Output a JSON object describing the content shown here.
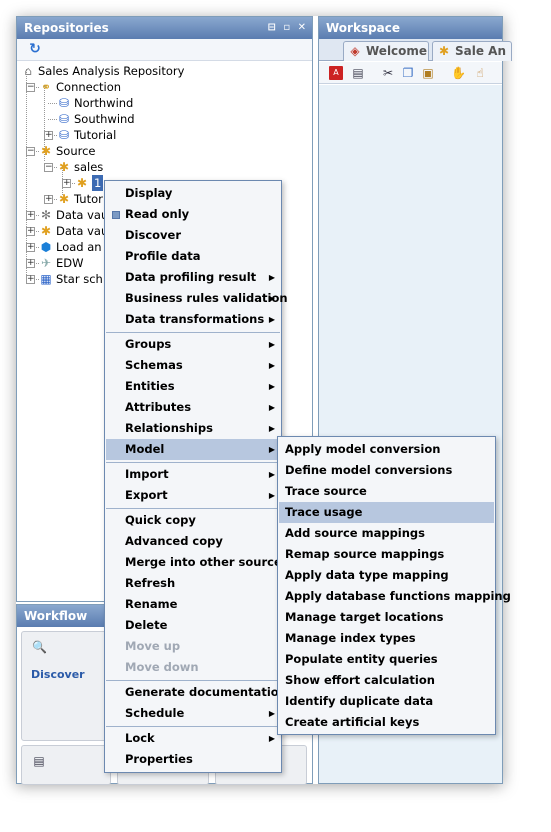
{
  "repositories": {
    "title": "Repositories",
    "controls": "⊟ ▫ ✕",
    "tree": [
      {
        "label": "Sales Analysis Repository",
        "icon": "repository-icon"
      },
      {
        "label": "Connection",
        "icon": "connection-icon"
      },
      {
        "label": "Northwind",
        "icon": "database-icon"
      },
      {
        "label": "Southwind",
        "icon": "database-icon"
      },
      {
        "label": "Tutorial",
        "icon": "database-icon"
      },
      {
        "label": "Source",
        "icon": "source-icon"
      },
      {
        "label": "sales",
        "icon": "source-icon"
      },
      {
        "label": "1",
        "icon": "source-icon"
      },
      {
        "label": "Tutor",
        "icon": "source-icon"
      },
      {
        "label": "Data vau",
        "icon": "data-vault-icon"
      },
      {
        "label": "Data vau",
        "icon": "data-vault-icon"
      },
      {
        "label": "Load an",
        "icon": "load-icon"
      },
      {
        "label": "EDW",
        "icon": "edw-icon"
      },
      {
        "label": "Star sch",
        "icon": "star-schema-icon"
      }
    ]
  },
  "workspace": {
    "title": "Workspace",
    "tabs": [
      {
        "label": "Welcome"
      },
      {
        "label": "Sale An"
      }
    ]
  },
  "workflow": {
    "title": "Workflow",
    "discover_label": "Discover"
  },
  "context_menu": {
    "items": [
      {
        "label": "Display"
      },
      {
        "label": "Read only"
      },
      {
        "label": "Discover"
      },
      {
        "label": "Profile data"
      },
      {
        "label": "Data profiling result"
      },
      {
        "label": "Business rules validation"
      },
      {
        "label": "Data transformations"
      },
      {
        "label": "Groups"
      },
      {
        "label": "Schemas"
      },
      {
        "label": "Entities"
      },
      {
        "label": "Attributes"
      },
      {
        "label": "Relationships"
      },
      {
        "label": "Model"
      },
      {
        "label": "Import"
      },
      {
        "label": "Export"
      },
      {
        "label": "Quick copy"
      },
      {
        "label": "Advanced copy"
      },
      {
        "label": "Merge into other source"
      },
      {
        "label": "Refresh"
      },
      {
        "label": "Rename"
      },
      {
        "label": "Delete"
      },
      {
        "label": "Move up"
      },
      {
        "label": "Move down"
      },
      {
        "label": "Generate documentation"
      },
      {
        "label": "Schedule"
      },
      {
        "label": "Lock"
      },
      {
        "label": "Properties"
      }
    ]
  },
  "model_submenu": {
    "items": [
      {
        "label": "Apply model conversion"
      },
      {
        "label": "Define model conversions"
      },
      {
        "label": "Trace source"
      },
      {
        "label": "Trace usage"
      },
      {
        "label": "Add source mappings"
      },
      {
        "label": "Remap source mappings"
      },
      {
        "label": "Apply data type mapping"
      },
      {
        "label": "Apply database functions mapping"
      },
      {
        "label": "Manage target locations"
      },
      {
        "label": "Manage index types"
      },
      {
        "label": "Populate entity queries"
      },
      {
        "label": "Show effort calculation"
      },
      {
        "label": "Identify duplicate data"
      },
      {
        "label": "Create artificial keys"
      }
    ]
  }
}
